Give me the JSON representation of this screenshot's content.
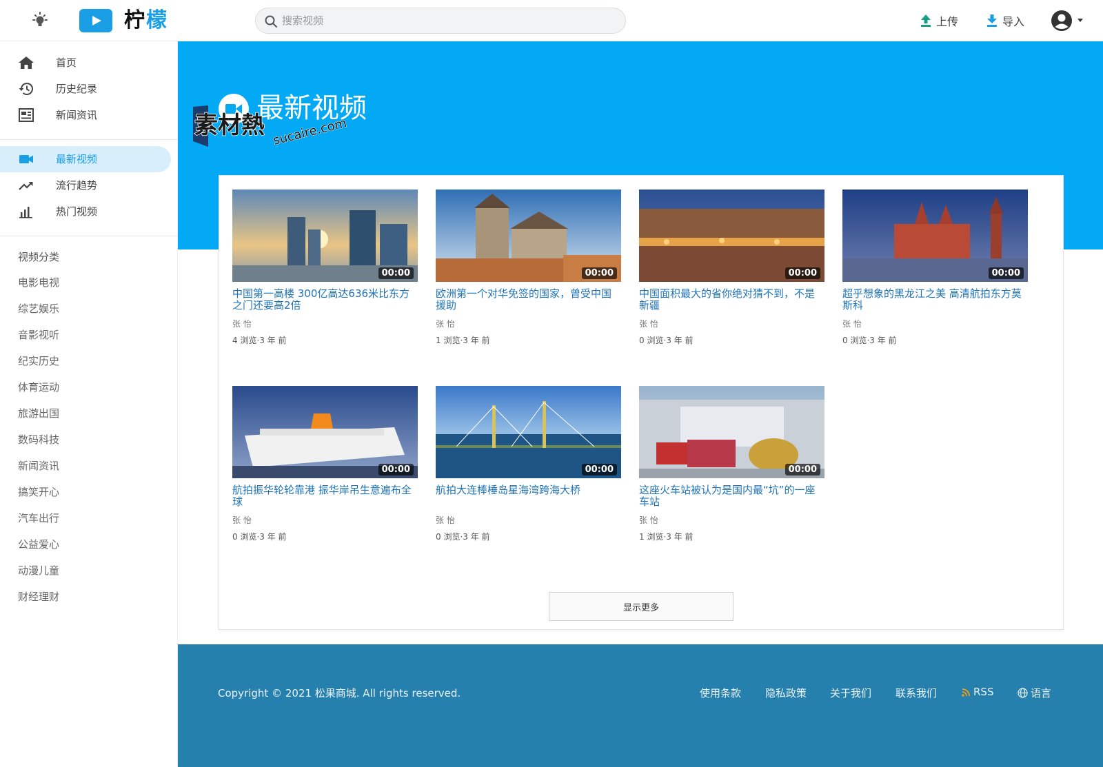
{
  "header": {
    "logo": {
      "part1": "柠",
      "part2": "檬"
    },
    "search_placeholder": "搜索视频",
    "upload_label": "上传",
    "import_label": "导入"
  },
  "sidebar": {
    "main": [
      {
        "label": "首页",
        "icon": "home-icon"
      },
      {
        "label": "历史纪录",
        "icon": "history-icon"
      },
      {
        "label": "新闻资讯",
        "icon": "news-icon"
      }
    ],
    "explore": [
      {
        "label": "最新视频",
        "icon": "video-camera-icon",
        "active": true
      },
      {
        "label": "流行趋势",
        "icon": "trending-icon"
      },
      {
        "label": "热门视频",
        "icon": "bar-chart-icon"
      }
    ],
    "categories_title": "视频分类",
    "categories": [
      "电影电视",
      "综艺娱乐",
      "音影视听",
      "纪实历史",
      "体育运动",
      "旅游出国",
      "数码科技",
      "新闻资讯",
      "搞笑开心",
      "汽车出行",
      "公益爱心",
      "动漫儿童",
      "财经理财"
    ]
  },
  "hero": {
    "title": "最新视频",
    "watermark": {
      "cn": "素材熱",
      "en": "sucaire.com"
    }
  },
  "videos": [
    {
      "title": "中国第一高楼 300亿高达636米比东方之门还要高2倍",
      "author": "张 怡",
      "views": "4 浏览",
      "age": "3 年 前",
      "duration": "00:00"
    },
    {
      "title": "欧洲第一个对华免签的国家，曾受中国援助",
      "author": "张 怡",
      "views": "1 浏览",
      "age": "3 年 前",
      "duration": "00:00"
    },
    {
      "title": "中国面积最大的省你绝对猜不到，不是新疆",
      "author": "张 怡",
      "views": "0 浏览",
      "age": "3 年 前",
      "duration": "00:00"
    },
    {
      "title": "超乎想象的黑龙江之美 高清航拍东方莫斯科",
      "author": "张 怡",
      "views": "0 浏览",
      "age": "3 年 前",
      "duration": "00:00"
    },
    {
      "title": "航拍振华轮轮靠港 振华岸吊生意遍布全球",
      "author": "张 怡",
      "views": "0 浏览",
      "age": "3 年 前",
      "duration": "00:00"
    },
    {
      "title": "航拍大连棒棰岛星海湾跨海大桥",
      "author": "张 怡",
      "views": "0 浏览",
      "age": "3 年 前",
      "duration": "00:00"
    },
    {
      "title": "这座火车站被认为是国内最“坑”的一座车站",
      "author": "张 怡",
      "views": "1 浏览",
      "age": "3 年 前",
      "duration": "00:00"
    }
  ],
  "meta_separator": "·",
  "show_more_label": "显示更多",
  "footer": {
    "copyright": "Copyright © 2021 松果商城. All rights reserved.",
    "links": [
      "使用条款",
      "隐私政策",
      "关于我们",
      "联系我们"
    ],
    "rss_label": "RSS",
    "language_label": "语言"
  },
  "colors": {
    "accent": "#03a9f4",
    "brand": "#1a9ee6",
    "footer": "#2680ad",
    "link": "#1f73b7"
  }
}
